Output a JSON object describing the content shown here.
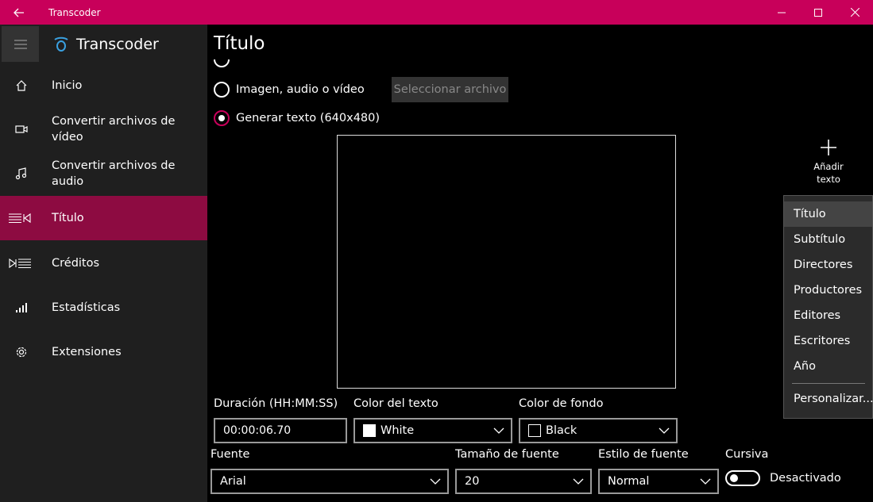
{
  "window": {
    "title": "Transcoder",
    "accent": "#c8005a"
  },
  "sidebar": {
    "app_name": "Transcoder",
    "items": [
      {
        "label": "Inicio",
        "icon": "home-icon"
      },
      {
        "label": "Convertir archivos de vídeo",
        "icon": "video-camera-icon"
      },
      {
        "label": "Convertir archivos de audio",
        "icon": "music-note-icon"
      },
      {
        "label": "Título",
        "icon": "title-icon",
        "active": true
      },
      {
        "label": "Créditos",
        "icon": "credits-icon"
      },
      {
        "label": "Estadísticas",
        "icon": "signal-bars-icon"
      },
      {
        "label": "Extensiones",
        "icon": "gear-icon"
      }
    ]
  },
  "main": {
    "title": "Título",
    "radio_media": "Imagen, audio o vídeo",
    "select_file": "Seleccionar archivo",
    "radio_text": "Generar texto (640x480)",
    "add_text_line1": "Añadir",
    "add_text_line2": "texto",
    "duration_label": "Duración (HH:MM:SS)",
    "duration_value": "00:00:06.70",
    "text_color_label": "Color del texto",
    "text_color_value": "White",
    "bg_color_label": "Color de fondo",
    "bg_color_value": "Black",
    "font_label": "Fuente",
    "font_value": "Arial",
    "font_size_label": "Tamaño de fuente",
    "font_size_value": "20",
    "font_style_label": "Estilo de fuente",
    "font_style_value": "Normal",
    "italic_label": "Cursiva",
    "italic_state": "Desactivado"
  },
  "menu": {
    "items": [
      "Título",
      "Subtítulo",
      "Directores",
      "Productores",
      "Editores",
      "Escritores",
      "Año"
    ],
    "custom": "Personalizar..."
  }
}
